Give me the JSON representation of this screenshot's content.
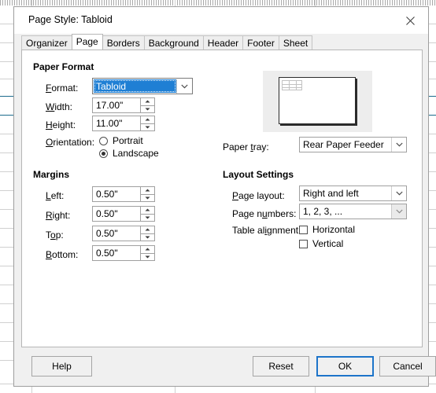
{
  "window": {
    "title": "Page Style: Tabloid",
    "close_icon": "close-icon"
  },
  "tabs": [
    {
      "label": "Organizer",
      "active": false
    },
    {
      "label": "Page",
      "active": true
    },
    {
      "label": "Borders",
      "active": false
    },
    {
      "label": "Background",
      "active": false
    },
    {
      "label": "Header",
      "active": false
    },
    {
      "label": "Footer",
      "active": false
    },
    {
      "label": "Sheet",
      "active": false
    }
  ],
  "paper_format": {
    "group_title": "Paper Format",
    "format": {
      "label": "Format:",
      "value": "Tabloid",
      "focused": true
    },
    "width": {
      "label": "Width:",
      "value": "17.00\""
    },
    "height": {
      "label": "Height:",
      "value": "11.00\""
    },
    "orientation": {
      "label": "Orientation:",
      "options": [
        {
          "label": "Portrait",
          "selected": false
        },
        {
          "label": "Landscape",
          "selected": true
        }
      ]
    }
  },
  "paper_tray": {
    "label": "Paper tray:",
    "value": "Rear Paper Feeder"
  },
  "margins": {
    "group_title": "Margins",
    "left": {
      "label": "Left:",
      "value": "0.50\""
    },
    "right": {
      "label": "Right:",
      "value": "0.50\""
    },
    "top": {
      "label": "Top:",
      "value": "0.50\""
    },
    "bottom": {
      "label": "Bottom:",
      "value": "0.50\""
    }
  },
  "layout_settings": {
    "group_title": "Layout Settings",
    "page_layout": {
      "label": "Page layout:",
      "value": "Right and left"
    },
    "page_numbers": {
      "label": "Page numbers:",
      "value": "1, 2, 3, ..."
    },
    "table_alignment": {
      "label": "Table alignment:",
      "options": [
        {
          "label": "Horizontal",
          "checked": false
        },
        {
          "label": "Vertical",
          "checked": false
        }
      ]
    }
  },
  "buttons": {
    "help": "Help",
    "reset": "Reset",
    "ok": "OK",
    "cancel": "Cancel"
  },
  "colors": {
    "accent_blue": "#1f7fd4",
    "focus_blue": "#1d74c9",
    "dialog_bg": "#f0f0f0",
    "panel_bg": "#ffffff"
  }
}
